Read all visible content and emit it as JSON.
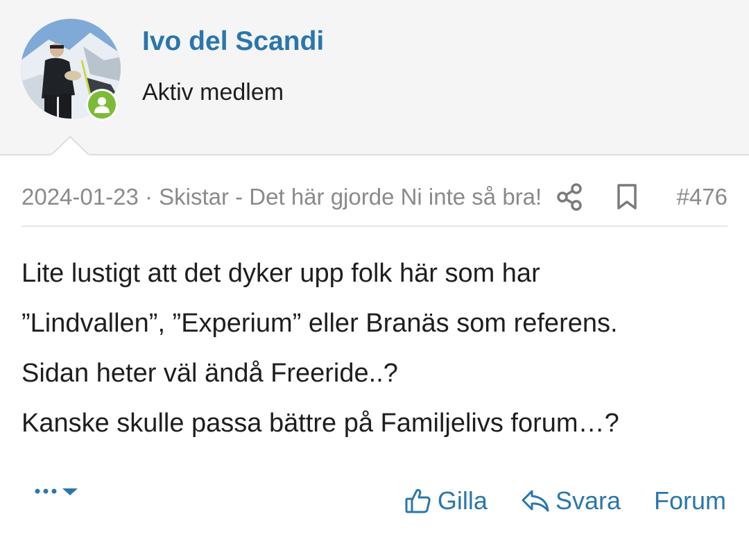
{
  "author": {
    "name": "Ivo del Scandi",
    "title": "Aktiv medlem",
    "avatar_icon": "avatar-photo",
    "status_icon": "user-online-icon"
  },
  "post": {
    "meta": "2024-01-23 · Skistar - Det här gjorde Ni inte så bra!",
    "number": "#476",
    "body": [
      "Lite lustigt att det dyker upp folk här som har",
      "”Lindvallen”, ”Experium” eller Branäs som referens.",
      "Sidan heter väl ändå Freeride..?",
      "Kanske skulle passa bättre på Familjelivs forum…?"
    ]
  },
  "actions": {
    "like": "Gilla",
    "reply": "Svara",
    "forum": "Forum"
  },
  "colors": {
    "accent": "#2a76ad",
    "online": "#7dbb37",
    "muted": "#8a8a8a"
  }
}
